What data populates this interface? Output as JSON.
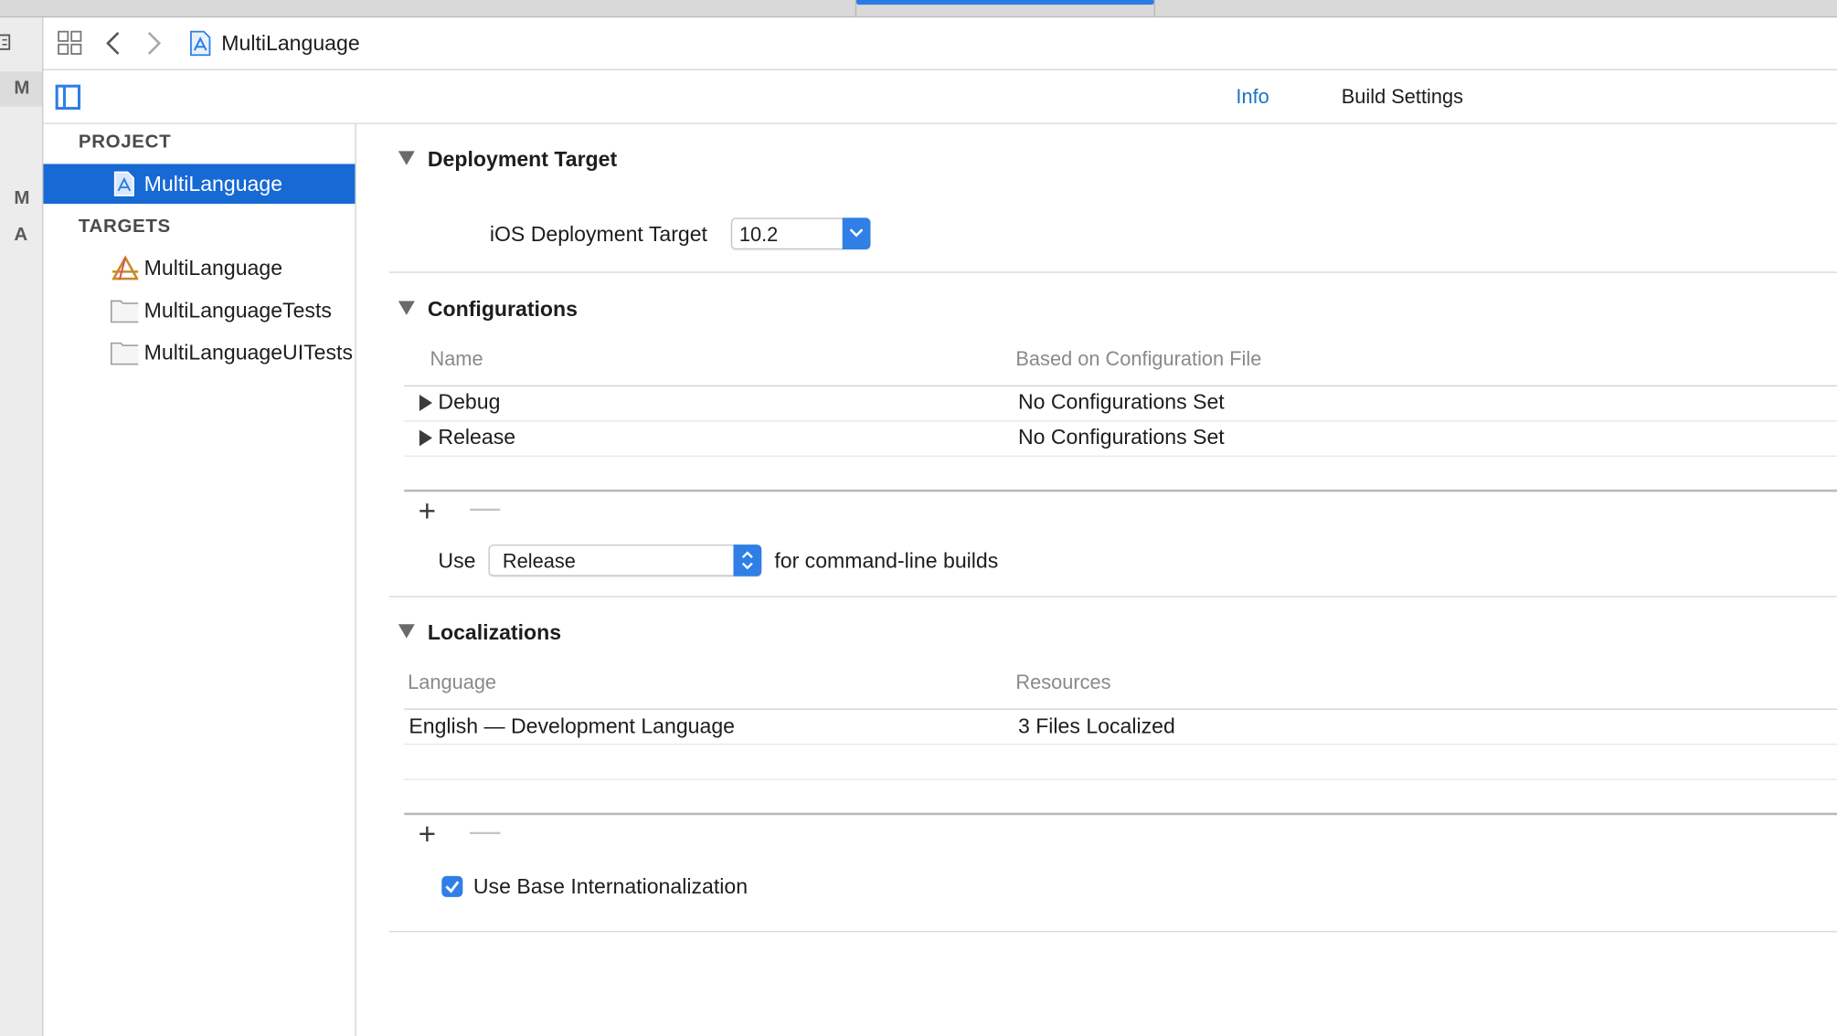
{
  "jumpbar": {
    "title": "MultiLanguage"
  },
  "edge": {
    "letters": [
      "M",
      "M",
      "A"
    ]
  },
  "tabs": [
    {
      "label": "Info",
      "active": true
    },
    {
      "label": "Build Settings",
      "active": false
    }
  ],
  "sidebar": {
    "project_header": "PROJECT",
    "project_items": [
      {
        "label": "MultiLanguage",
        "selected": true
      }
    ],
    "targets_header": "TARGETS",
    "target_items": [
      {
        "label": "MultiLanguage"
      },
      {
        "label": "MultiLanguageTests"
      },
      {
        "label": "MultiLanguageUITests"
      }
    ]
  },
  "deployment": {
    "title": "Deployment Target",
    "label": "iOS Deployment Target",
    "value": "10.2"
  },
  "configurations": {
    "title": "Configurations",
    "col_name": "Name",
    "col_file": "Based on Configuration File",
    "rows": [
      {
        "name": "Debug",
        "file": "No Configurations Set"
      },
      {
        "name": "Release",
        "file": "No Configurations Set"
      }
    ],
    "use_label": "Use",
    "use_value": "Release",
    "use_suffix": "for command-line builds"
  },
  "localizations": {
    "title": "Localizations",
    "col_language": "Language",
    "col_resources": "Resources",
    "rows": [
      {
        "language": "English — Development Language",
        "resources": "3 Files Localized"
      }
    ],
    "base_label": "Use Base Internationalization",
    "base_checked": true
  },
  "colors": {
    "accent": "#1769d4",
    "link": "#1a73c7"
  }
}
